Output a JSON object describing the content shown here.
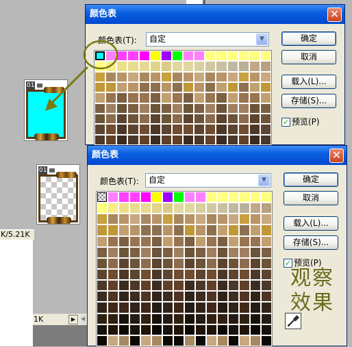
{
  "workspace": {
    "status_text": "K/5.21K",
    "scroll_text": "1K",
    "arrow_right": "▶",
    "arrow_left": "◀"
  },
  "thumbs": [
    {
      "frame_num": "01",
      "fill": "#00ffff"
    },
    {
      "frame_num": "01",
      "fill": "transparent"
    }
  ],
  "dialog1": {
    "title": "颜色表",
    "close_glyph": "✕",
    "table_label": "颜色表(T):",
    "table_value": "自定",
    "ok": "确定",
    "cancel": "取消",
    "load": "载入(L)...",
    "save": "存储(S)...",
    "preview": "预览(P)",
    "preview_checked": true,
    "first_color": "#00ffff"
  },
  "dialog2": {
    "title": "颜色表",
    "close_glyph": "✕",
    "table_label": "颜色表(T):",
    "table_value": "自定",
    "ok": "确定",
    "cancel": "取消",
    "load": "载入(L)...",
    "save": "存储(S)...",
    "preview": "预览(P)",
    "preview_checked": true,
    "first_color": "transparent"
  },
  "annotation": {
    "line1": "观察",
    "line2": "效果",
    "color": "#6b6b1e"
  },
  "palette": {
    "row0": [
      "#00ffff",
      "#ff80ff",
      "#ff40ff",
      "#ff40ff",
      "#ff00ff",
      "#ffff00",
      "#a000ff",
      "#00ff00",
      "#ff80ff",
      "#ff80ff",
      "#ffff80",
      "#ffff80",
      "#ffff80",
      "#ffff80",
      "#ffff80",
      "#ffff80"
    ],
    "row1": [
      "#ffff80",
      "#f8ec88",
      "#ece088",
      "#e8dc90",
      "#e8d890",
      "#e0d488",
      "#d8cc88",
      "#e0d8a0",
      "#e0d8a0",
      "#d8d0a0",
      "#d0c8a0",
      "#c8c0a0",
      "#c0b8a0",
      "#b8b098",
      "#c0a888",
      "#b8a080"
    ],
    "colors_cycle": [
      "#c8a880",
      "#a88860",
      "#b89468",
      "#8c7050",
      "#c0a070",
      "#987450",
      "#7c6044",
      "#a08060",
      "#6c5438",
      "#8c6c4c",
      "#5c4430",
      "#704c30",
      "#4c3828",
      "#604028",
      "#3c2c20",
      "#503424",
      "#30241a",
      "#402818",
      "#241c14",
      "#302010",
      "#18120c",
      "#201408",
      "#0c0804"
    ]
  }
}
